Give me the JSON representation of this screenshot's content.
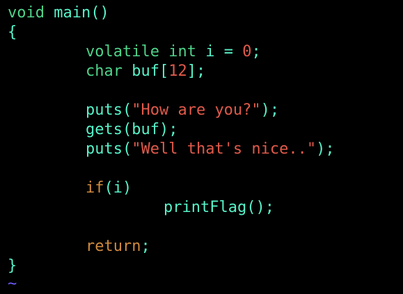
{
  "code": {
    "line0": {
      "kw": "void",
      "rest": " main()"
    },
    "line1": {
      "text": "{"
    },
    "line2": {
      "kw": "volatile int",
      "rest": " i = ",
      "num": "0",
      "end": ";"
    },
    "line3": {
      "kw": "char",
      "rest": " buf[",
      "num": "12",
      "end": "];"
    },
    "line4": {
      "fn": "puts(",
      "str": "\"How are you?\"",
      "end": ");"
    },
    "line5": {
      "text": "gets(buf);"
    },
    "line6": {
      "fn": "puts(",
      "str": "\"Well that's nice..\"",
      "end": ");"
    },
    "line7": {
      "kw": "if",
      "rest": "(i)"
    },
    "line8": {
      "text": "printFlag();"
    },
    "line9": {
      "kw": "return",
      "rest": ";"
    },
    "line10": {
      "text": "}"
    },
    "line11": {
      "text": "~"
    }
  },
  "colors": {
    "background": "#000000",
    "identifier": "#57f3c9",
    "type_keyword": "#4fd38a",
    "control_keyword": "#d08a3e",
    "literal": "#e05a4b",
    "tilde": "#6b5cff"
  }
}
